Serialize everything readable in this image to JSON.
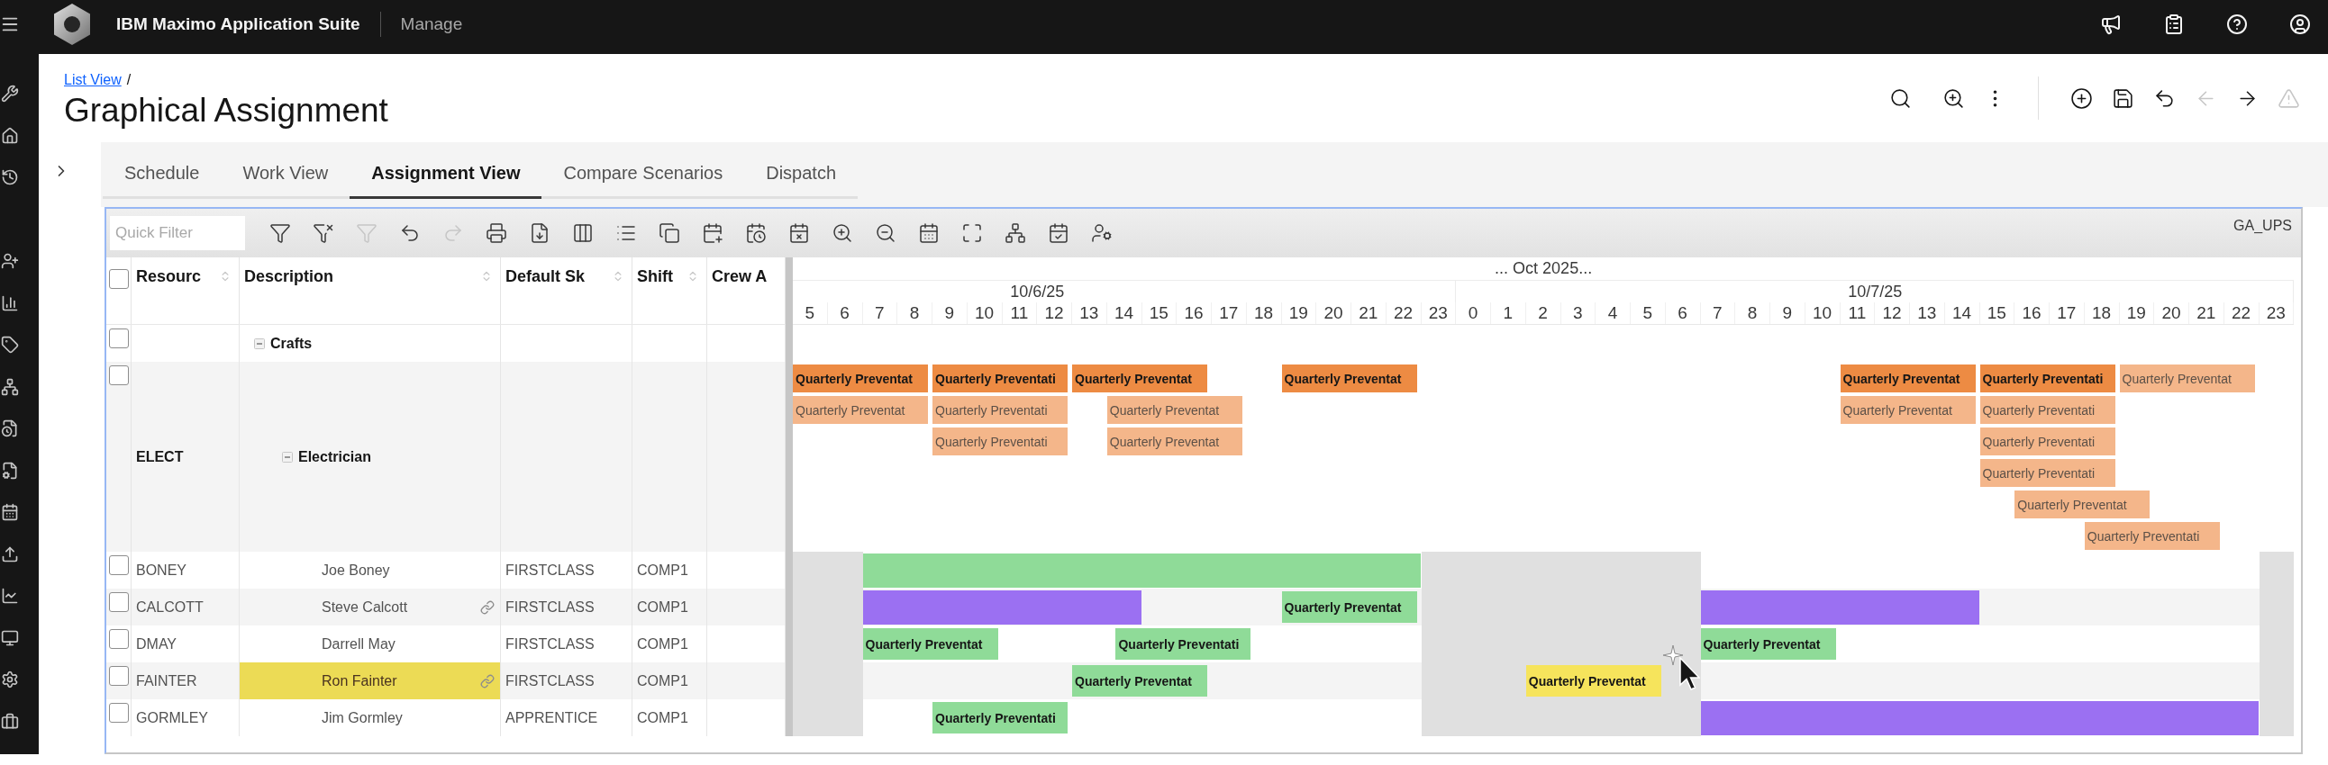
{
  "top_bar": {
    "product": "IBM Maximo Application Suite",
    "app": "Manage"
  },
  "breadcrumb": {
    "link": "List View",
    "separator": "/"
  },
  "title": "Graphical Assignment",
  "page_actions": [
    {
      "disabled": false
    },
    {
      "disabled": false
    },
    {
      "disabled": false
    },
    {
      "disabled": false
    },
    {
      "disabled": false
    },
    {
      "disabled": false
    },
    {
      "disabled": true
    },
    {
      "disabled": false
    },
    {
      "disabled": true
    }
  ],
  "tabs": [
    {
      "label": "Schedule",
      "selected": false
    },
    {
      "label": "Work View",
      "selected": false
    },
    {
      "label": "Assignment View",
      "selected": true
    },
    {
      "label": "Compare Scenarios",
      "selected": false
    },
    {
      "label": "Dispatch",
      "selected": false
    }
  ],
  "toolbar": {
    "quick_filter": {
      "placeholder": "Quick Filter"
    },
    "buttons": [
      {
        "disabled": false
      },
      {
        "disabled": false
      },
      {
        "disabled": true
      },
      {
        "disabled": false
      },
      {
        "disabled": true
      },
      {
        "disabled": false
      },
      {
        "disabled": false
      },
      {
        "disabled": false
      },
      {
        "disabled": false
      },
      {
        "disabled": false
      },
      {
        "disabled": false
      },
      {
        "disabled": false
      },
      {
        "disabled": false
      },
      {
        "disabled": false
      },
      {
        "disabled": false
      },
      {
        "disabled": false
      },
      {
        "disabled": false
      },
      {
        "disabled": false
      },
      {
        "disabled": false
      },
      {
        "disabled": false
      }
    ],
    "view_name": "GA_UPS"
  },
  "table": {
    "header_checkbox": {
      "checked": false
    },
    "columns": [
      {
        "label": "Resourc",
        "sortable": true
      },
      {
        "label": "Description",
        "sortable": true
      },
      {
        "label": "Default Sk",
        "sortable": true
      },
      {
        "label": "Shift",
        "sortable": true
      },
      {
        "label": "Crew A",
        "sortable": false
      }
    ],
    "rows": [
      {
        "kind": "group",
        "checked": false,
        "expanded": true,
        "description": "Crafts",
        "children": [
          {
            "kind": "craft",
            "checked": false,
            "expanded": true,
            "resource": "ELECT",
            "description": "Electrician",
            "lanes": [
              {
                "bars": [
                  {
                    "color": "#ed8b43",
                    "muted": false,
                    "label": "Quarterly Preventat"
                  },
                  {
                    "color": "#ed8b43",
                    "muted": false,
                    "label": "Quarterly Preventati"
                  },
                  {
                    "color": "#ed8b43",
                    "muted": false,
                    "label": "Quarterly Preventat"
                  },
                  {
                    "color": "#ed8b43",
                    "muted": false,
                    "label": "Quarterly Preventat"
                  },
                  {
                    "color": "#ed8b43",
                    "muted": false,
                    "label": "Quarterly Preventat"
                  },
                  {
                    "color": "#ed8b43",
                    "muted": false,
                    "label": "Quarterly Preventati"
                  },
                  {
                    "color": "#f4b68a",
                    "muted": true,
                    "label": "Quarterly Preventat"
                  }
                ]
              },
              {
                "bars": [
                  {
                    "color": "#f4b68a",
                    "muted": true,
                    "label": "Quarterly Preventat"
                  },
                  {
                    "color": "#f4b68a",
                    "muted": true,
                    "label": "Quarterly Preventati"
                  },
                  {
                    "color": "#f4b68a",
                    "muted": true,
                    "label": "Quarterly Preventat"
                  },
                  {
                    "color": "#f4b68a",
                    "muted": true,
                    "label": "Quarterly Preventat"
                  },
                  {
                    "color": "#f4b68a",
                    "muted": true,
                    "label": "Quarterly Preventati"
                  }
                ]
              },
              {
                "bars": [
                  {
                    "color": "#f4b68a",
                    "muted": true,
                    "label": "Quarterly Preventati"
                  },
                  {
                    "color": "#f4b68a",
                    "muted": true,
                    "label": "Quarterly Preventat"
                  },
                  {
                    "color": "#f4b68a",
                    "muted": true,
                    "label": "Quarterly Preventati"
                  }
                ]
              },
              {
                "bars": [
                  {
                    "color": "#f4b68a",
                    "muted": true,
                    "label": "Quarterly Preventati"
                  }
                ]
              },
              {
                "bars": [
                  {
                    "color": "#f4b68a",
                    "muted": true,
                    "label": "Quarterly Preventat"
                  }
                ]
              },
              {
                "bars": [
                  {
                    "color": "#f4b68a",
                    "muted": true,
                    "label": "Quarterly Preventati"
                  }
                ]
              }
            ],
            "children": [
              {
                "kind": "person",
                "checked": false,
                "highlighted": false,
                "linked": false,
                "resource": "BONEY",
                "description": "Joe Boney",
                "skill": "FIRSTCLASS",
                "shift": "COMP1",
                "bars": [
                  {
                    "color": "#8fdb98"
                  }
                ]
              },
              {
                "kind": "person",
                "checked": false,
                "highlighted": false,
                "linked": true,
                "resource": "CALCOTT",
                "description": "Steve Calcott",
                "skill": "FIRSTCLASS",
                "shift": "COMP1",
                "bars": [
                  {
                    "color": "#9b70f2"
                  },
                  {
                    "color": "#8fdb98",
                    "label": "Quarterly Preventat"
                  },
                  {
                    "color": "#9b70f2"
                  }
                ]
              },
              {
                "kind": "person",
                "checked": false,
                "highlighted": false,
                "linked": false,
                "resource": "DMAY",
                "description": "Darrell May",
                "skill": "FIRSTCLASS",
                "shift": "COMP1",
                "bars": [
                  {
                    "color": "#8fdb98",
                    "label": "Quarterly Preventat"
                  },
                  {
                    "color": "#8fdb98",
                    "label": "Quarterly Preventati"
                  },
                  {
                    "color": "#8fdb98",
                    "label": "Quarterly Preventat"
                  }
                ]
              },
              {
                "kind": "person",
                "checked": false,
                "highlighted": true,
                "linked": true,
                "resource": "FAINTER",
                "description": "Ron Fainter",
                "skill": "FIRSTCLASS",
                "shift": "COMP1",
                "bars": [
                  {
                    "color": "#8fdb98",
                    "label": "Quarterly Preventat"
                  },
                  {
                    "color": "#f6e45c",
                    "label": "Quarterly Preventat"
                  }
                ]
              },
              {
                "kind": "person",
                "checked": false,
                "highlighted": false,
                "linked": false,
                "resource": "GORMLEY",
                "description": "Jim Gormley",
                "skill": "APPRENTICE",
                "shift": "COMP1",
                "bars": [
                  {
                    "color": "#8fdb98",
                    "label": "Quarterly Preventati"
                  },
                  {
                    "color": "#9b70f2"
                  }
                ]
              }
            ]
          }
        ]
      }
    ]
  },
  "gantt": {
    "period": "... Oct 2025...",
    "days": [
      {
        "date": "10/6/25",
        "hours": [
          "5",
          "6",
          "7",
          "8",
          "9",
          "10",
          "11",
          "12",
          "13",
          "14",
          "15",
          "16",
          "17",
          "18",
          "19",
          "20",
          "21",
          "22",
          "23"
        ]
      },
      {
        "date": "10/7/25",
        "hours": [
          "0",
          "1",
          "2",
          "3",
          "4",
          "5",
          "6",
          "7",
          "8",
          "9",
          "10",
          "11",
          "12",
          "13",
          "14",
          "15",
          "16",
          "17",
          "18",
          "19",
          "20",
          "21",
          "22",
          "23"
        ]
      }
    ]
  }
}
